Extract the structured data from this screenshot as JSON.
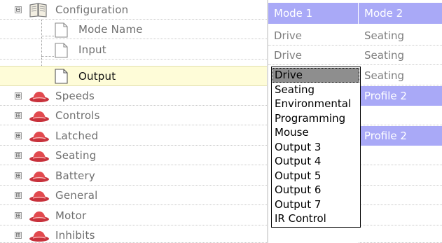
{
  "tree": {
    "items": [
      {
        "label": "Configuration",
        "expander": "⊟",
        "icon": "open-book-icon"
      },
      {
        "label": "Mode Name",
        "icon": "document-icon"
      },
      {
        "label": "Input",
        "icon": "document-icon"
      },
      {
        "label": "Output",
        "icon": "document-icon",
        "selected": true
      },
      {
        "label": "Speeds",
        "expander": "⊞",
        "icon": "red-hat-icon"
      },
      {
        "label": "Controls",
        "expander": "⊞",
        "icon": "red-hat-icon"
      },
      {
        "label": "Latched",
        "expander": "⊞",
        "icon": "red-hat-icon"
      },
      {
        "label": "Seating",
        "expander": "⊞",
        "icon": "red-hat-icon"
      },
      {
        "label": "Battery",
        "expander": "⊞",
        "icon": "red-hat-icon"
      },
      {
        "label": "General",
        "expander": "⊞",
        "icon": "red-hat-icon"
      },
      {
        "label": "Motor",
        "expander": "⊞",
        "icon": "red-hat-icon"
      },
      {
        "label": "Inhibits",
        "expander": "⊞",
        "icon": "red-hat-icon"
      }
    ]
  },
  "grid": {
    "header": {
      "mode1": "Mode 1",
      "mode2": "Mode 2"
    },
    "mode_name": {
      "mode1": "Drive",
      "mode2": "Seating"
    },
    "input": {
      "mode1": "Drive",
      "mode2": "Seating"
    },
    "output": {
      "mode1": "Drive",
      "mode2": "Seating"
    },
    "speeds_profile2": "Profile 2",
    "latched_profile2": "Profile 2"
  },
  "dropdown": {
    "selected": "Drive",
    "options": [
      "Drive",
      "Seating",
      "Environmental",
      "Programming",
      "Mouse",
      "Output 3",
      "Output 4",
      "Output 5",
      "Output 6",
      "Output 7",
      "IR Control"
    ]
  },
  "colors": {
    "header_bg": "#a9a9f7",
    "selected_row_bg": "#fefcd8",
    "highlight_option": "#8e8e8e"
  }
}
